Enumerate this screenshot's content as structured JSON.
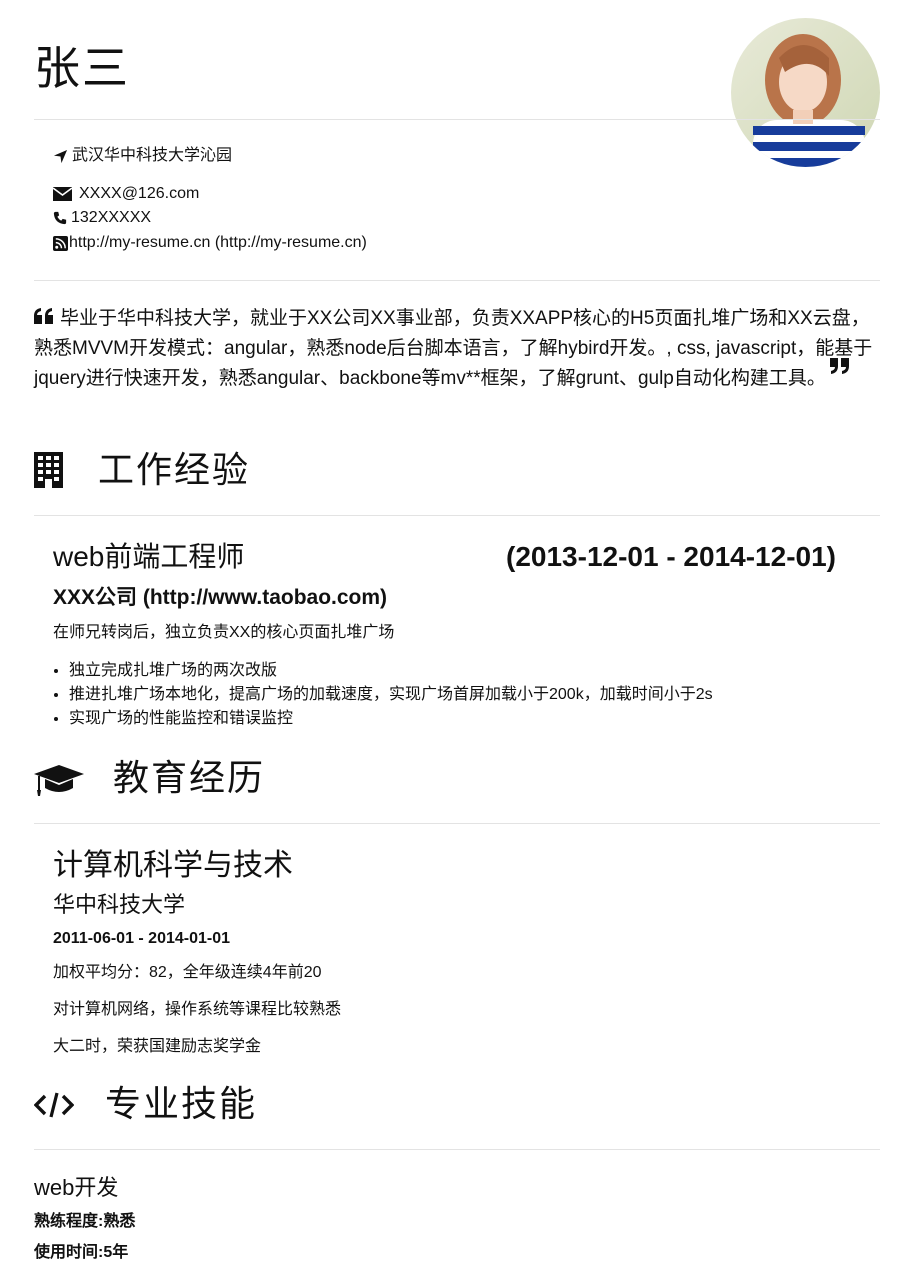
{
  "profile": {
    "name": "张三",
    "location": "武汉华中科技大学沁园",
    "email": "XXXX@126.com",
    "phone": "132XXXXX",
    "website": "http://my-resume.cn (http://my-resume.cn)"
  },
  "summary": "毕业于华中科技大学，就业于XX公司XX事业部，负责XXAPP核心的H5页面扎堆广场和XX云盘，熟悉MVVM开发模式：angular，熟悉node后台脚本语言，了解hybird开发。, css, javascript，能基于jquery进行快速开发，熟悉angular、backbone等mv**框架，了解grunt、gulp自动化构建工具。",
  "work": {
    "heading": "工作经验",
    "title": "web前端工程师",
    "date": "(2013-12-01 - 2014-12-01)",
    "company": "XXX公司 (http://www.taobao.com)",
    "desc": "在师兄转岗后，独立负责XX的核心页面扎堆广场",
    "bullets": [
      "独立完成扎堆广场的两次改版",
      "推进扎堆广场本地化，提高广场的加载速度，实现广场首屏加载小于200k，加载时间小于2s",
      "实现广场的性能监控和错误监控"
    ]
  },
  "education": {
    "heading": "教育经历",
    "major": "计算机科学与技术",
    "school": "华中科技大学",
    "date": "2011-06-01 - 2014-01-01",
    "lines": [
      "加权平均分：82，全年级连续4年前20",
      "对计算机网络，操作系统等课程比较熟悉",
      "大二时，荣获国建励志奖学金"
    ]
  },
  "skills": {
    "heading": "专业技能",
    "name": "web开发",
    "level": "熟练程度:熟悉",
    "years": "使用时间:5年"
  },
  "icons": [
    "location-arrow-icon",
    "envelope-icon",
    "phone-icon",
    "rss-icon",
    "quote-left-icon",
    "quote-right-icon",
    "building-icon",
    "graduation-cap-icon",
    "code-icon"
  ]
}
